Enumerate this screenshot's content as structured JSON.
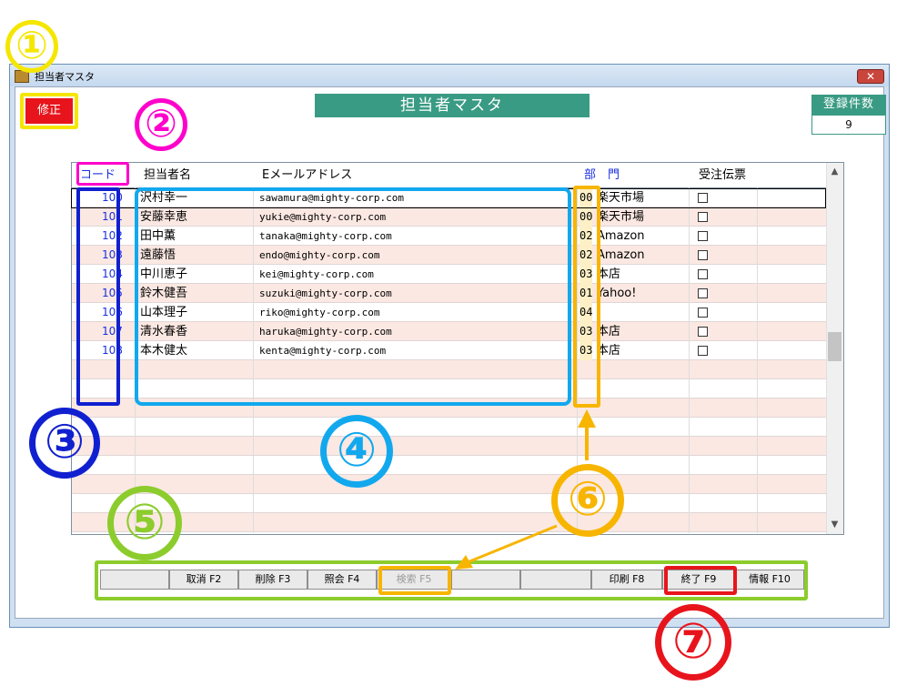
{
  "window": {
    "title": "担当者マスタ",
    "close_glyph": "✕"
  },
  "header": {
    "mode_label": "修正",
    "screen_title": "担当者マスタ",
    "count_label": "登録件数",
    "count_value": "9"
  },
  "table": {
    "columns": [
      "コード",
      "担当者名",
      "Eメールアドレス",
      "部　門",
      "受注伝票"
    ],
    "rows": [
      {
        "code": "100",
        "name": "沢村幸一",
        "email": "sawamura@mighty-corp.com",
        "dept_code": "00",
        "dept_name": "楽天市場"
      },
      {
        "code": "101",
        "name": "安藤幸恵",
        "email": "yukie@mighty-corp.com",
        "dept_code": "00",
        "dept_name": "楽天市場"
      },
      {
        "code": "102",
        "name": "田中薫",
        "email": "tanaka@mighty-corp.com",
        "dept_code": "02",
        "dept_name": "Amazon"
      },
      {
        "code": "103",
        "name": "遠藤悟",
        "email": "endo@mighty-corp.com",
        "dept_code": "02",
        "dept_name": "Amazon"
      },
      {
        "code": "104",
        "name": "中川恵子",
        "email": "kei@mighty-corp.com",
        "dept_code": "03",
        "dept_name": "本店"
      },
      {
        "code": "105",
        "name": "鈴木健吾",
        "email": "suzuki@mighty-corp.com",
        "dept_code": "01",
        "dept_name": "Yahoo!"
      },
      {
        "code": "106",
        "name": "山本理子",
        "email": "riko@mighty-corp.com",
        "dept_code": "04",
        "dept_name": ""
      },
      {
        "code": "107",
        "name": "清水春香",
        "email": "haruka@mighty-corp.com",
        "dept_code": "03",
        "dept_name": "本店"
      },
      {
        "code": "108",
        "name": "本木健太",
        "email": "kenta@mighty-corp.com",
        "dept_code": "03",
        "dept_name": "本店"
      }
    ]
  },
  "function_keys": [
    "",
    "取消 F2",
    "削除 F3",
    "照会 F4",
    "検索 F5",
    "",
    "",
    "印刷 F8",
    "終了 F9",
    "情報 F10"
  ],
  "annotations": [
    "①",
    "②",
    "③",
    "④",
    "⑤",
    "⑥",
    "⑦"
  ],
  "colors": {
    "accent": "#3a9b84",
    "mode": "#e8141c",
    "code_text": "#1a2fe0",
    "alt_row": "#fbe8e2",
    "ann1": "#f5e600",
    "ann2": "#ff00cc",
    "ann3": "#1020d0",
    "ann4": "#12a8ee",
    "ann5": "#8ccc2c",
    "ann6": "#f7b500",
    "ann7": "#e8141c"
  }
}
